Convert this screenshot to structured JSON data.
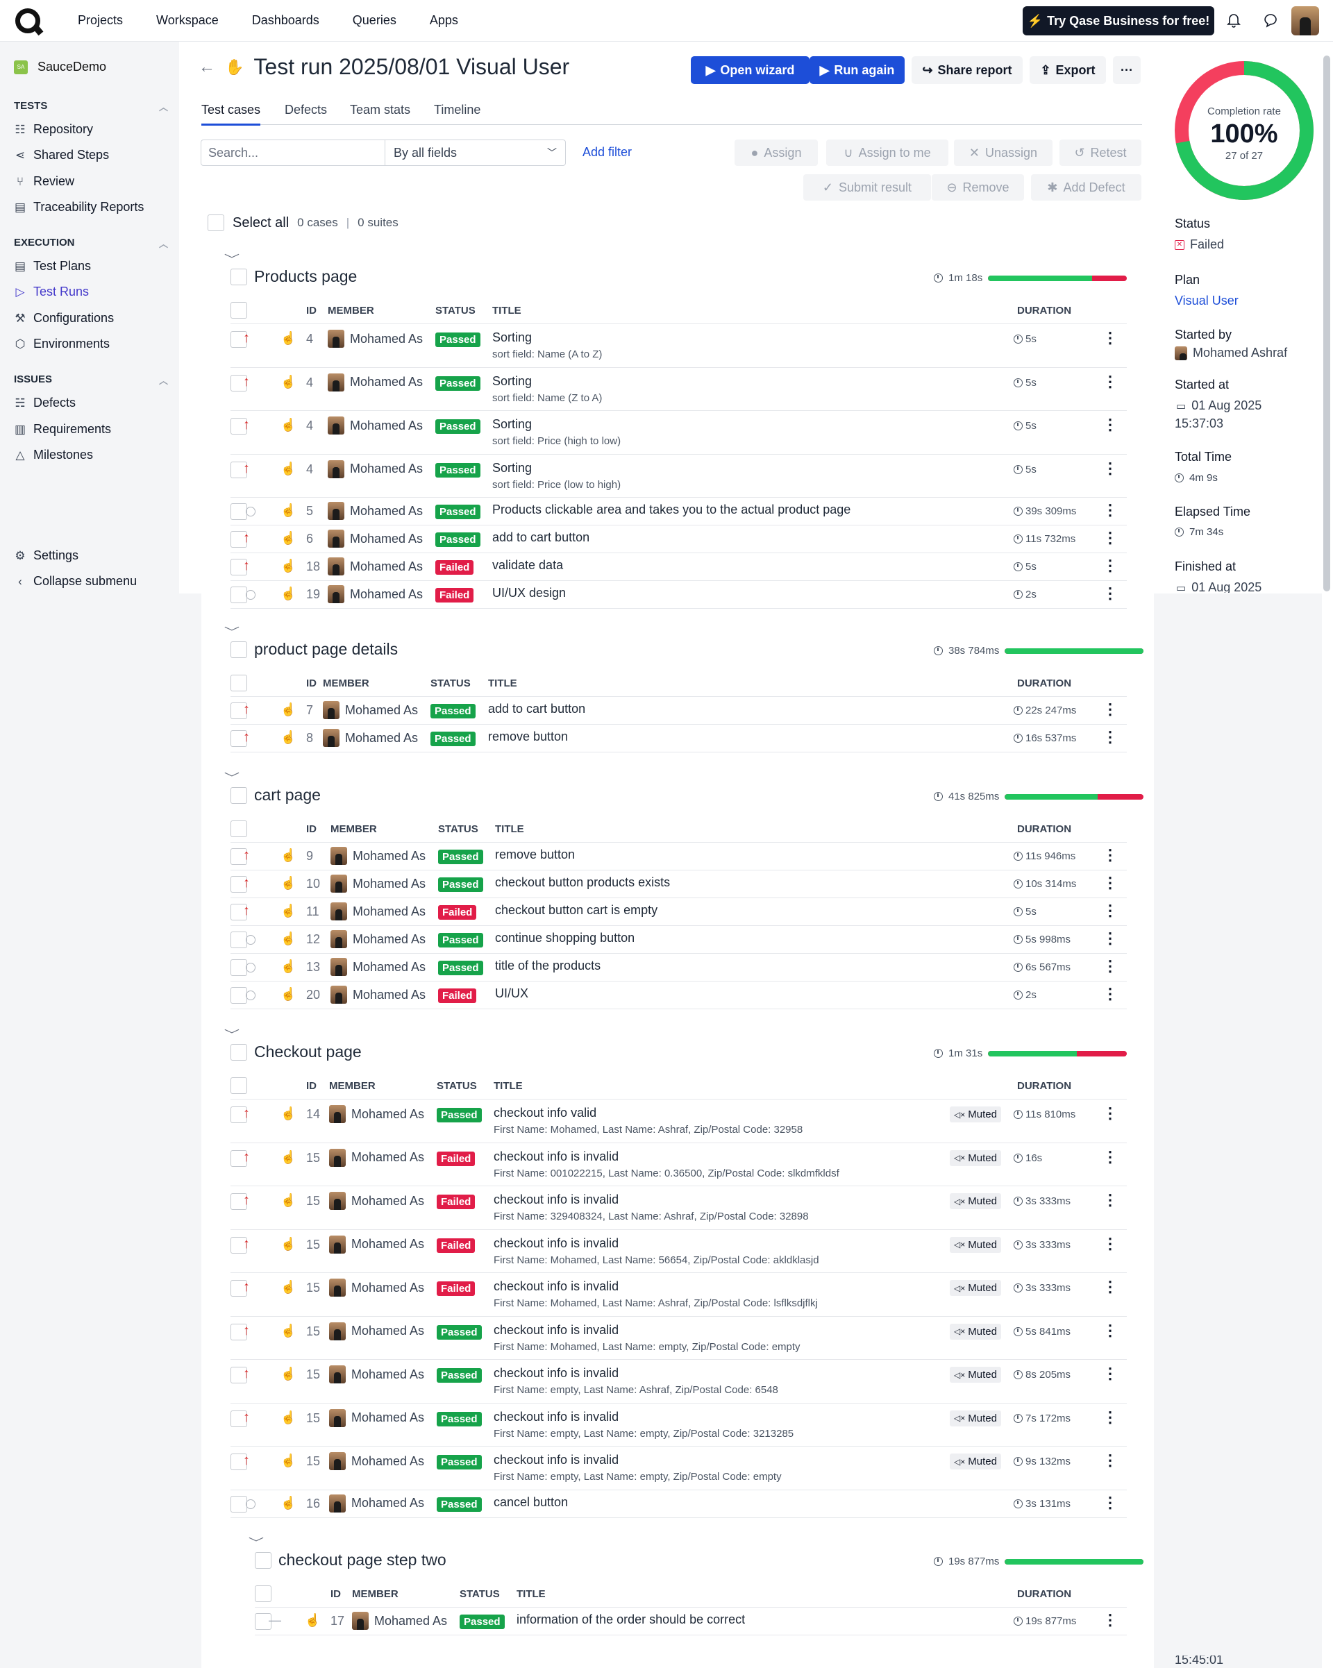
{
  "nav": {
    "projects": "Projects",
    "workspace": "Workspace",
    "dashboards": "Dashboards",
    "queries": "Queries",
    "apps": "Apps",
    "try_business": "Try Qase Business for free!"
  },
  "sidebar": {
    "project": "SauceDemo",
    "project_initials": "SA",
    "tests_heading": "TESTS",
    "execution_heading": "EXECUTION",
    "issues_heading": "ISSUES",
    "items": [
      {
        "label": "Repository",
        "icon": "repository-icon"
      },
      {
        "label": "Shared Steps",
        "icon": "shared-steps-icon"
      },
      {
        "label": "Review",
        "icon": "review-icon"
      },
      {
        "label": "Traceability Reports",
        "icon": "traceability-icon"
      },
      {
        "label": "Test Plans",
        "icon": "test-plans-icon"
      },
      {
        "label": "Test Runs",
        "icon": "play-icon"
      },
      {
        "label": "Configurations",
        "icon": "wrench-icon"
      },
      {
        "label": "Environments",
        "icon": "box-icon"
      },
      {
        "label": "Defects",
        "icon": "bug-icon"
      },
      {
        "label": "Requirements",
        "icon": "document-icon"
      },
      {
        "label": "Milestones",
        "icon": "milestone-icon"
      }
    ],
    "settings": "Settings",
    "collapse": "Collapse submenu"
  },
  "header": {
    "title": "Test run 2025/08/01 Visual User",
    "open_wizard": "Open wizard",
    "run_again": "Run again",
    "share_report": "Share report",
    "export": "Export",
    "more": "···"
  },
  "tabs": [
    "Test cases",
    "Defects",
    "Team stats",
    "Timeline"
  ],
  "filters": {
    "search_placeholder": "Search...",
    "field_select": "By all fields",
    "add_filter": "Add filter"
  },
  "actions": {
    "assign": "Assign",
    "assign_to_me": "Assign to me",
    "unassign": "Unassign",
    "retest": "Retest",
    "submit_result": "Submit result",
    "remove": "Remove",
    "add_defect": "Add Defect"
  },
  "select_all": {
    "label": "Select all",
    "cases": "0 cases",
    "suites": "0 suites"
  },
  "columns": {
    "id": "ID",
    "member": "MEMBER",
    "status": "STATUS",
    "title": "TITLE",
    "duration": "DURATION"
  },
  "muted_label": "Muted",
  "suites": [
    {
      "name": "Products page",
      "time": "1m 18s",
      "pass_ratio": 0.75,
      "rows": [
        {
          "prio": "high",
          "id": "4",
          "member": "Mohamed As",
          "status": "Passed",
          "title": "Sorting",
          "sub": "sort field: Name (A to Z)",
          "dur": "5s"
        },
        {
          "prio": "high",
          "id": "4",
          "member": "Mohamed As",
          "status": "Passed",
          "title": "Sorting",
          "sub": "sort field: Name (Z to A)",
          "dur": "5s"
        },
        {
          "prio": "high",
          "id": "4",
          "member": "Mohamed As",
          "status": "Passed",
          "title": "Sorting",
          "sub": "sort field: Price (high to low)",
          "dur": "5s"
        },
        {
          "prio": "high",
          "id": "4",
          "member": "Mohamed As",
          "status": "Passed",
          "title": "Sorting",
          "sub": "sort field: Price (low to high)",
          "dur": "5s"
        },
        {
          "prio": "low",
          "id": "5",
          "member": "Mohamed As",
          "status": "Passed",
          "title": "Products clickable area and takes you to the actual product page",
          "dur": "39s 309ms"
        },
        {
          "prio": "high",
          "id": "6",
          "member": "Mohamed As",
          "status": "Passed",
          "title": "add to cart button",
          "dur": "11s 732ms"
        },
        {
          "prio": "high",
          "id": "18",
          "member": "Mohamed As",
          "status": "Failed",
          "title": "validate data",
          "dur": "5s"
        },
        {
          "prio": "low",
          "id": "19",
          "member": "Mohamed As",
          "status": "Failed",
          "title": "UI/UX design",
          "dur": "2s"
        }
      ]
    },
    {
      "name": "product page details",
      "time": "38s 784ms",
      "pass_ratio": 1,
      "rows": [
        {
          "prio": "high",
          "id": "7",
          "member": "Mohamed As",
          "status": "Passed",
          "title": "add to cart button",
          "dur": "22s 247ms"
        },
        {
          "prio": "high",
          "id": "8",
          "member": "Mohamed As",
          "status": "Passed",
          "title": "remove button",
          "dur": "16s 537ms"
        }
      ]
    },
    {
      "name": "cart page",
      "time": "41s 825ms",
      "pass_ratio": 0.67,
      "rows": [
        {
          "prio": "high",
          "id": "9",
          "member": "Mohamed As",
          "status": "Passed",
          "title": "remove button",
          "dur": "11s 946ms"
        },
        {
          "prio": "high",
          "id": "10",
          "member": "Mohamed As",
          "status": "Passed",
          "title": "checkout button products exists",
          "dur": "10s 314ms"
        },
        {
          "prio": "high",
          "id": "11",
          "member": "Mohamed As",
          "status": "Failed",
          "title": "checkout button cart is empty",
          "dur": "5s"
        },
        {
          "prio": "low",
          "id": "12",
          "member": "Mohamed As",
          "status": "Passed",
          "title": "continue shopping button",
          "dur": "5s 998ms"
        },
        {
          "prio": "low",
          "id": "13",
          "member": "Mohamed As",
          "status": "Passed",
          "title": "title of the products",
          "dur": "6s 567ms"
        },
        {
          "prio": "low",
          "id": "20",
          "member": "Mohamed As",
          "status": "Failed",
          "title": "UI/UX",
          "dur": "2s"
        }
      ]
    },
    {
      "name": "Checkout page",
      "time": "1m 31s",
      "pass_ratio": 0.64,
      "rows": [
        {
          "prio": "high",
          "id": "14",
          "member": "Mohamed As",
          "status": "Passed",
          "title": "checkout info valid",
          "sub": "First Name: Mohamed, Last Name: Ashraf, Zip/Postal Code: 32958",
          "dur": "11s 810ms",
          "muted": true
        },
        {
          "prio": "high",
          "id": "15",
          "member": "Mohamed As",
          "status": "Failed",
          "title": "checkout info is invalid",
          "sub": "First Name: 001022215, Last Name: 0.36500, Zip/Postal Code: slkdmfkldsf",
          "dur": "16s",
          "muted": true
        },
        {
          "prio": "high",
          "id": "15",
          "member": "Mohamed As",
          "status": "Failed",
          "title": "checkout info is invalid",
          "sub": "First Name: 329408324, Last Name: Ashraf, Zip/Postal Code: 32898",
          "dur": "3s 333ms",
          "muted": true
        },
        {
          "prio": "high",
          "id": "15",
          "member": "Mohamed As",
          "status": "Failed",
          "title": "checkout info is invalid",
          "sub": "First Name: Mohamed, Last Name: 56654, Zip/Postal Code: akldklasjd",
          "dur": "3s 333ms",
          "muted": true
        },
        {
          "prio": "high",
          "id": "15",
          "member": "Mohamed As",
          "status": "Failed",
          "title": "checkout info is invalid",
          "sub": "First Name: Mohamed, Last Name: Ashraf, Zip/Postal Code: lsflksdjflkj",
          "dur": "3s 333ms",
          "muted": true
        },
        {
          "prio": "high",
          "id": "15",
          "member": "Mohamed As",
          "status": "Passed",
          "title": "checkout info is invalid",
          "sub": "First Name: Mohamed, Last Name: empty, Zip/Postal Code: empty",
          "dur": "5s 841ms",
          "muted": true
        },
        {
          "prio": "high",
          "id": "15",
          "member": "Mohamed As",
          "status": "Passed",
          "title": "checkout info is invalid",
          "sub": "First Name: empty, Last Name: Ashraf, Zip/Postal Code: 6548",
          "dur": "8s 205ms",
          "muted": true
        },
        {
          "prio": "high",
          "id": "15",
          "member": "Mohamed As",
          "status": "Passed",
          "title": "checkout info is invalid",
          "sub": "First Name: empty, Last Name: empty, Zip/Postal Code: 3213285",
          "dur": "7s 172ms",
          "muted": true
        },
        {
          "prio": "high",
          "id": "15",
          "member": "Mohamed As",
          "status": "Passed",
          "title": "checkout info is invalid",
          "sub": "First Name: empty, Last Name: empty, Zip/Postal Code: empty",
          "dur": "9s 132ms",
          "muted": true
        },
        {
          "prio": "low",
          "id": "16",
          "member": "Mohamed As",
          "status": "Passed",
          "title": "cancel button",
          "dur": "3s 131ms"
        }
      ]
    },
    {
      "name": "checkout page step two",
      "time": "19s 877ms",
      "pass_ratio": 1,
      "rows": [
        {
          "prio": "none",
          "id": "17",
          "member": "Mohamed As",
          "status": "Passed",
          "title": "information of the order should be correct",
          "dur": "19s 877ms"
        }
      ]
    }
  ],
  "summary": {
    "completion_label": "Completion rate",
    "completion_value": "100%",
    "completion_count": "27 of 27",
    "pass_ratio": 0.72,
    "status_label": "Status",
    "status_value": "Failed",
    "plan_label": "Plan",
    "plan_value": "Visual User",
    "started_by_label": "Started by",
    "started_by_value": "Mohamed Ashraf",
    "started_at_label": "Started at",
    "started_at_date": "01 Aug 2025",
    "started_at_time": "15:37:03",
    "total_time_label": "Total Time",
    "total_time_value": "4m 9s",
    "elapsed_label": "Elapsed Time",
    "elapsed_value": "7m 34s",
    "finished_label": "Finished at",
    "finished_date": "01 Aug 2025",
    "finished_time": "15:45:01"
  },
  "colors": {
    "primary": "#1d4ed8",
    "passed": "#16a34a",
    "failed": "#e11d48",
    "progress_green": "#22c55e"
  }
}
